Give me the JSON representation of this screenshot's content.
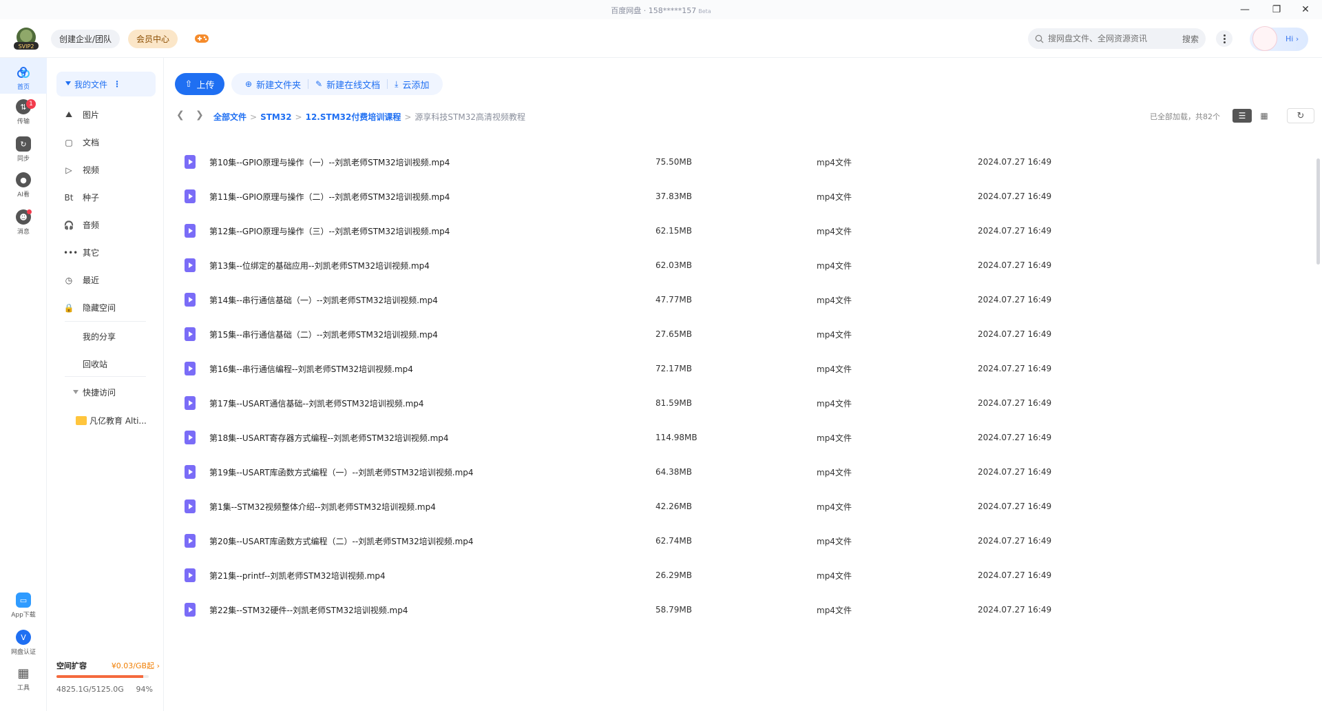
{
  "window": {
    "title": "百度网盘 · 158*****157",
    "beta": "Beta"
  },
  "topbar": {
    "logo_text": "SVIP2",
    "team_label": "创建企业/团队",
    "vip_label": "会员中心",
    "search_placeholder": "搜网盘文件、全网资源资讯",
    "search_button": "搜索",
    "hi_label": "Hi"
  },
  "rail": {
    "items": [
      {
        "label": "首页",
        "icon": "home-cloud-icon",
        "active": true
      },
      {
        "label": "传输",
        "icon": "transfer-icon",
        "badge": "1"
      },
      {
        "label": "同步",
        "icon": "sync-icon"
      },
      {
        "label": "AI看",
        "icon": "ai-icon"
      },
      {
        "label": "消息",
        "icon": "message-icon"
      }
    ],
    "bottom_items": [
      {
        "label": "App下载",
        "icon": "app-download-icon"
      },
      {
        "label": "网盘认证",
        "icon": "verify-icon"
      },
      {
        "label": "工具",
        "icon": "tools-icon"
      }
    ]
  },
  "sidebar": {
    "my_files": "我的文件",
    "items": [
      {
        "label": "图片",
        "icon": "image-icon",
        "glyph": "⛰"
      },
      {
        "label": "文档",
        "icon": "document-icon",
        "glyph": "▢"
      },
      {
        "label": "视频",
        "icon": "video-icon",
        "glyph": "▷"
      },
      {
        "label": "种子",
        "icon": "torrent-icon",
        "glyph": "Bt"
      },
      {
        "label": "音频",
        "icon": "audio-icon",
        "glyph": "🎧"
      },
      {
        "label": "其它",
        "icon": "other-icon",
        "glyph": "•••"
      },
      {
        "label": "最近",
        "icon": "recent-icon",
        "glyph": "◷"
      },
      {
        "label": "隐藏空间",
        "icon": "lock-icon",
        "glyph": "🔒"
      }
    ],
    "my_share": "我的分享",
    "recycle": "回收站",
    "quick_access": "快捷访问",
    "quick_folder": "凡亿教育 Alti...",
    "storage": {
      "title": "空间扩容",
      "price": "¥0.03/GB起",
      "usage": "4825.1G/5125.0G",
      "percent": "94%",
      "fill_fraction": 0.94
    }
  },
  "toolbar": {
    "upload": "上传",
    "new_folder": "新建文件夹",
    "new_doc": "新建在线文档",
    "cloud_add": "云添加"
  },
  "breadcrumb": {
    "parts": [
      "全部文件",
      "STM32",
      "12.STM32付费培训课程"
    ],
    "current": "源享科技STM32高清视频教程"
  },
  "status": {
    "loaded": "已全部加载，共82个"
  },
  "files": [
    {
      "name": "第10集--GPIO原理与操作（一）--刘凯老师STM32培训视频.mp4",
      "size": "75.50MB",
      "type": "mp4文件",
      "date": "2024.07.27 16:49"
    },
    {
      "name": "第11集--GPIO原理与操作（二）--刘凯老师STM32培训视频.mp4",
      "size": "37.83MB",
      "type": "mp4文件",
      "date": "2024.07.27 16:49"
    },
    {
      "name": "第12集--GPIO原理与操作（三）--刘凯老师STM32培训视频.mp4",
      "size": "62.15MB",
      "type": "mp4文件",
      "date": "2024.07.27 16:49"
    },
    {
      "name": "第13集--位绑定的基础应用--刘凯老师STM32培训视频.mp4",
      "size": "62.03MB",
      "type": "mp4文件",
      "date": "2024.07.27 16:49"
    },
    {
      "name": "第14集--串行通信基础（一）--刘凯老师STM32培训视频.mp4",
      "size": "47.77MB",
      "type": "mp4文件",
      "date": "2024.07.27 16:49"
    },
    {
      "name": "第15集--串行通信基础（二）--刘凯老师STM32培训视频.mp4",
      "size": "27.65MB",
      "type": "mp4文件",
      "date": "2024.07.27 16:49"
    },
    {
      "name": "第16集--串行通信编程--刘凯老师STM32培训视频.mp4",
      "size": "72.17MB",
      "type": "mp4文件",
      "date": "2024.07.27 16:49"
    },
    {
      "name": "第17集--USART通信基础--刘凯老师STM32培训视频.mp4",
      "size": "81.59MB",
      "type": "mp4文件",
      "date": "2024.07.27 16:49"
    },
    {
      "name": "第18集--USART寄存器方式编程--刘凯老师STM32培训视频.mp4",
      "size": "114.98MB",
      "type": "mp4文件",
      "date": "2024.07.27 16:49"
    },
    {
      "name": "第19集--USART库函数方式编程（一）--刘凯老师STM32培训视频.mp4",
      "size": "64.38MB",
      "type": "mp4文件",
      "date": "2024.07.27 16:49"
    },
    {
      "name": "第1集--STM32视频整体介绍--刘凯老师STM32培训视频.mp4",
      "size": "42.26MB",
      "type": "mp4文件",
      "date": "2024.07.27 16:49"
    },
    {
      "name": "第20集--USART库函数方式编程（二）--刘凯老师STM32培训视频.mp4",
      "size": "62.74MB",
      "type": "mp4文件",
      "date": "2024.07.27 16:49"
    },
    {
      "name": "第21集--printf--刘凯老师STM32培训视频.mp4",
      "size": "26.29MB",
      "type": "mp4文件",
      "date": "2024.07.27 16:49"
    },
    {
      "name": "第22集--STM32硬件--刘凯老师STM32培训视频.mp4",
      "size": "58.79MB",
      "type": "mp4文件",
      "date": "2024.07.27 16:49"
    }
  ],
  "colors": {
    "accent": "#1f6ff2",
    "video_icon": "#7a6cf7",
    "badge": "#f23c4d",
    "storage_fill": "#f46a3e"
  }
}
